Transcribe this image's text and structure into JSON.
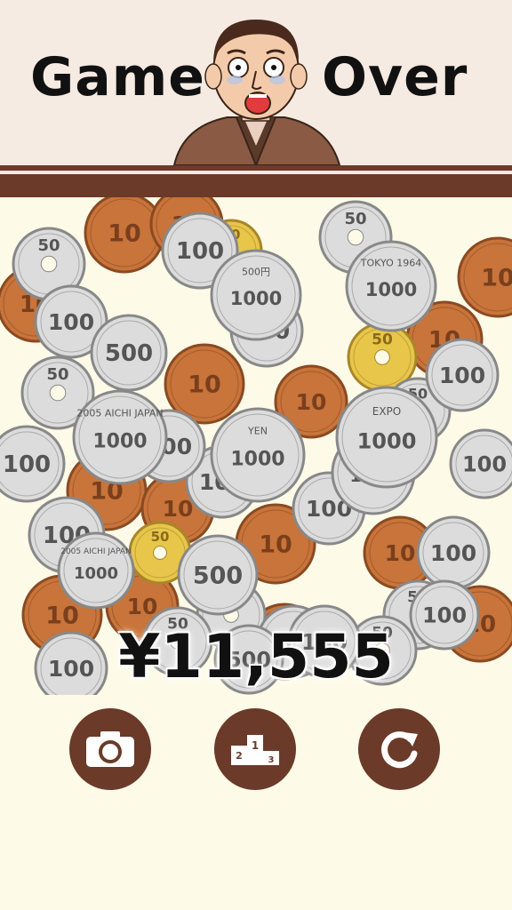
{
  "header": {
    "title_left": "Game",
    "title_right": "Over"
  },
  "result": {
    "total": "¥11,555"
  },
  "actions": [
    {
      "name": "camera-button",
      "icon": "camera-icon"
    },
    {
      "name": "ranking-button",
      "icon": "podium-icon",
      "labels": [
        "1",
        "2",
        "3"
      ]
    },
    {
      "name": "retry-button",
      "icon": "retry-icon"
    }
  ],
  "coins": {
    "labels": [
      "10",
      "50",
      "100",
      "500",
      "1000"
    ],
    "special": [
      "EXPO",
      "2005 AICHI JAPAN",
      "TOKYO 1964",
      "YEN",
      "500円"
    ],
    "colors": {
      "bronze": "#c8743a",
      "silver": "#dcdcdc",
      "gold": "#e8c64a",
      "brown": "#6b3a28"
    }
  }
}
